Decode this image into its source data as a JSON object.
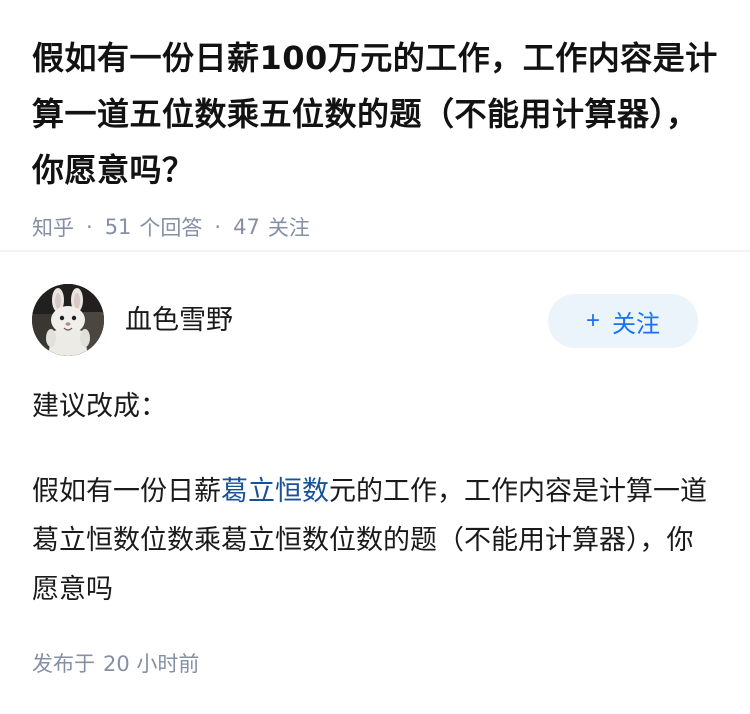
{
  "question": {
    "title": "假如有一份日薪100万元的工作，工作内容是计算一道五位数乘五位数的题（不能用计算器），你愿意吗？",
    "meta": {
      "source": "知乎",
      "separator": "·",
      "answers_count": "51",
      "answers_label": "个回答",
      "followers_count": "47",
      "followers_label": "关注"
    }
  },
  "answer": {
    "author": {
      "name": "血色雪野",
      "avatar_icon": "rabbit-avatar"
    },
    "follow_button": {
      "plus": "+",
      "label": "关注"
    },
    "paragraph1": "建议改成：",
    "paragraph2": {
      "part1": "假如有一份日薪",
      "link": "葛立恒数",
      "part2": "元的工作，工作内容是计算一道葛立恒数位数乘葛立恒数位数的题（不能用计算器），你愿意吗"
    },
    "published": {
      "label": "发布于",
      "time": "20 小时前"
    }
  },
  "colors": {
    "meta_gray": "#8590a6",
    "link_blue": "#175199",
    "follow_blue": "#1772f6",
    "follow_bg": "#ebf3fb"
  }
}
